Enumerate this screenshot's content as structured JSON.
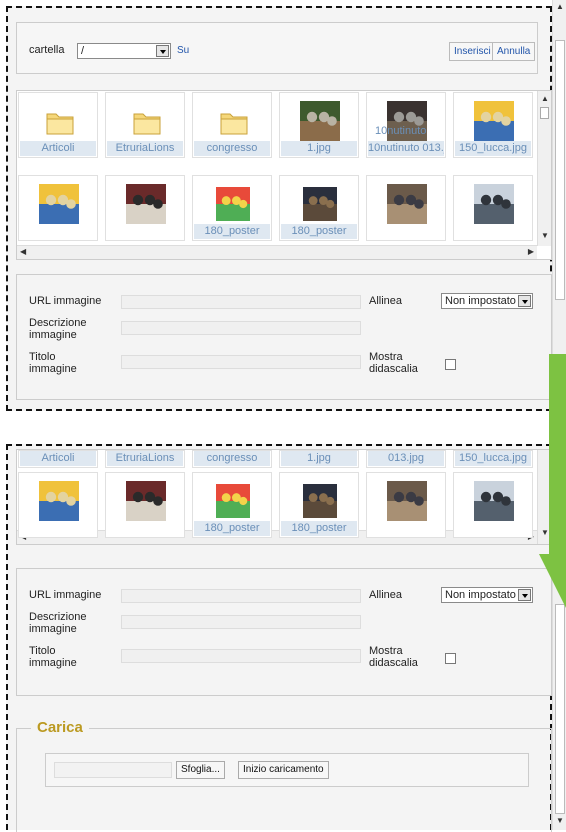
{
  "toolbar": {
    "folder_label": "cartella",
    "folder_value": "/",
    "up_label": "Su",
    "insert_label": "Inserisci",
    "cancel_label": "Annulla"
  },
  "files": [
    {
      "name": "Articoli",
      "kind": "folder"
    },
    {
      "name": "EtruriaLions",
      "kind": "folder"
    },
    {
      "name": "congresso",
      "kind": "folder"
    },
    {
      "name": "1.jpg",
      "kind": "image"
    },
    {
      "name": "10nutinuto 013.jpg",
      "kind": "image",
      "overlay": "10nutinuto"
    },
    {
      "name": "150_lucca.jpg",
      "kind": "image"
    },
    {
      "name": "",
      "kind": "image"
    },
    {
      "name": "",
      "kind": "image"
    },
    {
      "name": "180_poster",
      "kind": "image"
    },
    {
      "name": "180_poster",
      "kind": "image"
    },
    {
      "name": "",
      "kind": "image"
    },
    {
      "name": "",
      "kind": "image"
    }
  ],
  "scrolled_captions": [
    "Articoli",
    "EtruriaLions",
    "congresso",
    "1.jpg",
    "013.jpg",
    "150_lucca.jpg"
  ],
  "form": {
    "url_label": "URL immagine",
    "align_label": "Allinea",
    "align_value": "Non impostato",
    "desc_label_1": "Descrizione",
    "desc_label_2": "immagine",
    "title_label_1": "Titolo",
    "title_label_2": "immagine",
    "caption_label_1": "Mostra",
    "caption_label_2": "didascalia"
  },
  "upload": {
    "legend": "Carica",
    "browse_label": "Sfoglia...",
    "start_label": "Inizio caricamento"
  },
  "colors": {
    "accent_link": "#2255aa",
    "caption_bg": "#dfe8f1",
    "legend": "#bb9a22",
    "arrow": "#7dc242"
  }
}
